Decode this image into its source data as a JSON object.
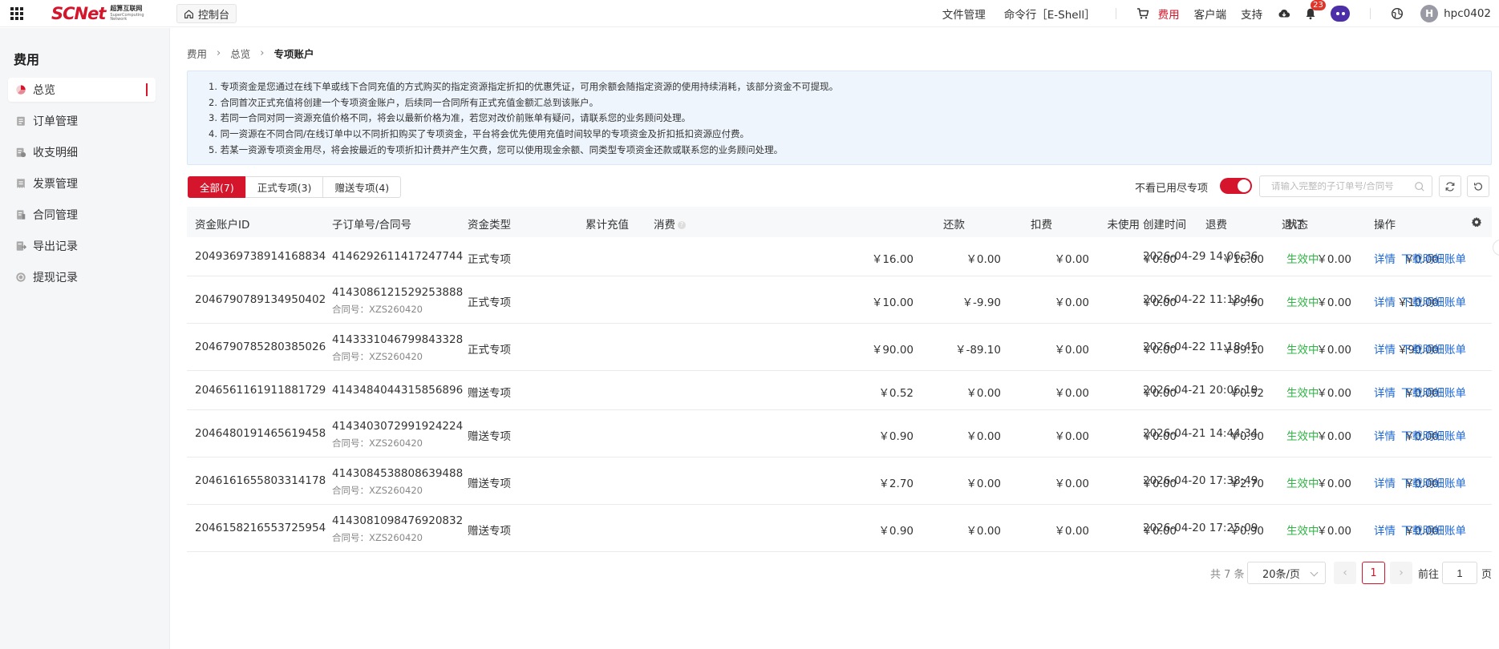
{
  "topbar": {
    "logo_text": "SCNet",
    "logo_cn": "超算互联网",
    "logo_en": "SuperComputing Network",
    "console_label": "控制台",
    "links": [
      "文件管理",
      "命令行［E-Shell］"
    ],
    "billing_label": "费用",
    "client_label": "客户端",
    "support_label": "支持",
    "notification_count": "23",
    "avatar_letter": "H",
    "username": "hpc0402"
  },
  "sidebar": {
    "title": "费用",
    "items": [
      {
        "label": "总览",
        "icon": "pie-chart-icon"
      },
      {
        "label": "订单管理",
        "icon": "order-icon"
      },
      {
        "label": "收支明细",
        "icon": "ledger-icon"
      },
      {
        "label": "发票管理",
        "icon": "invoice-icon"
      },
      {
        "label": "合同管理",
        "icon": "contract-icon"
      },
      {
        "label": "导出记录",
        "icon": "export-icon"
      },
      {
        "label": "提现记录",
        "icon": "withdraw-icon"
      }
    ]
  },
  "breadcrumb": [
    "费用",
    "总览",
    "专项账户"
  ],
  "notice": [
    "1. 专项资金是您通过在线下单或线下合同充值的方式购买的指定资源指定折扣的优惠凭证，可用余额会随指定资源的使用持续消耗，该部分资金不可提现。",
    "2. 合同首次正式充值将创建一个专项资金账户，后续同一合同所有正式充值金额汇总到该账户。",
    "3. 若同一合同对同一资源充值价格不同，将会以最新价格为准，若您对改价前账单有疑问，请联系您的业务顾问处理。",
    "4. 同一资源在不同合同/在线订单中以不同折扣购买了专项资金，平台将会优先使用充值时间较早的专项资金及折扣抵扣资源应付费。",
    "5. 若某一资源专项资金用尽，将会按最近的专项折扣计费并产生欠费，您可以使用现金余额、同类型专项资金还款或联系您的业务顾问处理。"
  ],
  "tabs": [
    "全部(7)",
    "正式专项(3)",
    "赠送专项(4)"
  ],
  "filter": {
    "hide_used_label": "不看已用尽专项",
    "search_placeholder": "请输入完整的子订单号/合同号"
  },
  "table": {
    "headers": [
      "资金账户ID",
      "子订单号/合同号",
      "资金类型",
      "累计充值",
      "消费",
      "还款",
      "扣费",
      "未使用",
      "退费",
      "退订",
      "创建时间",
      "状态",
      "操作"
    ],
    "rows": [
      {
        "id": "2049369738914168834",
        "order": "4146292611417247744",
        "contract": "",
        "type": "正式专项",
        "recharge": "￥16.00",
        "consume": "￥0.00",
        "repay": "￥0.00",
        "deduct": "￥0.00",
        "unused": "￥16.00",
        "refund": "￥0.00",
        "unsubscribe": "￥0.00",
        "created": "2026-04-29 14:06:36",
        "status": "生效中",
        "op_detail": "详情",
        "op_download": "下载明细账单"
      },
      {
        "id": "2046790789134950402",
        "order": "4143086121529253888",
        "contract": "合同号：XZS260420",
        "type": "正式专项",
        "recharge": "￥10.00",
        "consume": "￥-9.90",
        "repay": "￥0.00",
        "deduct": "￥0.00",
        "unused": "￥9.90",
        "refund": "￥0.00",
        "unsubscribe": "￥10.00",
        "created": "2026-04-22 11:18:46",
        "status": "生效中",
        "op_detail": "详情",
        "op_download": "下载明细账单"
      },
      {
        "id": "2046790785280385026",
        "order": "4143331046799843328",
        "contract": "合同号：XZS260420",
        "type": "正式专项",
        "recharge": "￥90.00",
        "consume": "￥-89.10",
        "repay": "￥0.00",
        "deduct": "￥0.00",
        "unused": "￥89.10",
        "refund": "￥0.00",
        "unsubscribe": "￥90.00",
        "created": "2026-04-22 11:18:45",
        "status": "生效中",
        "op_detail": "详情",
        "op_download": "下载明细账单"
      },
      {
        "id": "2046561161911881729",
        "order": "4143484044315856896",
        "contract": "",
        "type": "赠送专项",
        "recharge": "￥0.52",
        "consume": "￥0.00",
        "repay": "￥0.00",
        "deduct": "￥0.00",
        "unused": "￥0.52",
        "refund": "￥0.00",
        "unsubscribe": "￥0.00",
        "created": "2026-04-21 20:06:19",
        "status": "生效中",
        "op_detail": "详情",
        "op_download": "下载明细账单"
      },
      {
        "id": "2046480191465619458",
        "order": "4143403072991924224",
        "contract": "合同号：XZS260420",
        "type": "赠送专项",
        "recharge": "￥0.90",
        "consume": "￥0.00",
        "repay": "￥0.00",
        "deduct": "￥0.00",
        "unused": "￥0.90",
        "refund": "￥0.00",
        "unsubscribe": "￥0.00",
        "created": "2026-04-21 14:44:34",
        "status": "生效中",
        "op_detail": "详情",
        "op_download": "下载明细账单"
      },
      {
        "id": "2046161655803314178",
        "order": "4143084538808639488",
        "contract": "合同号：XZS260420",
        "type": "赠送专项",
        "recharge": "￥2.70",
        "consume": "￥0.00",
        "repay": "￥0.00",
        "deduct": "￥0.00",
        "unused": "￥2.70",
        "refund": "￥0.00",
        "unsubscribe": "￥0.00",
        "created": "2026-04-20 17:38:49",
        "status": "生效中",
        "op_detail": "详情",
        "op_download": "下载明细账单"
      },
      {
        "id": "2046158216553725954",
        "order": "4143081098476920832",
        "contract": "合同号：XZS260420",
        "type": "赠送专项",
        "recharge": "￥0.90",
        "consume": "￥0.00",
        "repay": "￥0.00",
        "deduct": "￥0.00",
        "unused": "￥0.90",
        "refund": "￥0.00",
        "unsubscribe": "￥0.00",
        "created": "2026-04-20 17:25:09",
        "status": "生效中",
        "op_detail": "详情",
        "op_download": "下载明细账单"
      }
    ]
  },
  "pagination": {
    "total": "共 7 条",
    "page_size": "20条/页",
    "current_page": "1",
    "goto_label": "前往",
    "goto_value": "1",
    "page_suffix": "页"
  },
  "colors": {
    "brand": "#d4152b",
    "status_active": "#2fb344",
    "link": "#1a66d6"
  }
}
